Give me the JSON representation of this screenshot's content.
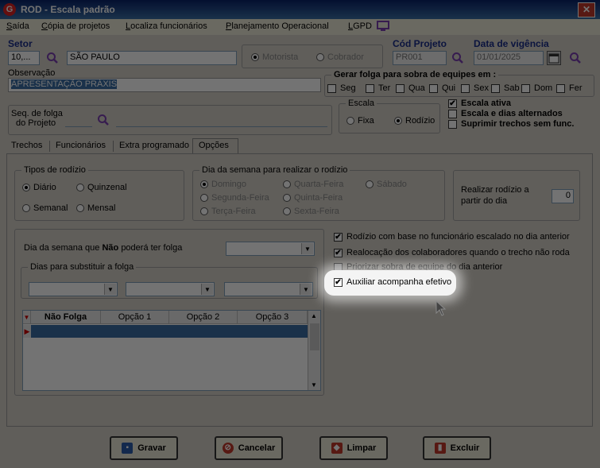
{
  "window": {
    "title": "ROD - Escala padrão"
  },
  "menu": {
    "items": [
      "Saída",
      "Cópia de projetos",
      "Localiza funcionários",
      "Planejamento Operacional",
      "LGPD"
    ],
    "underline": [
      "S",
      "C",
      "L",
      "P",
      "L"
    ]
  },
  "header": {
    "setor_label": "Setor",
    "setor_code": "10,...",
    "setor_name": "SÃO PAULO",
    "motorista": "Motorista",
    "cobrador": "Cobrador",
    "cod_projeto_label": "Cód Projeto",
    "cod_projeto_value": "PR001",
    "data_vigencia_label": "Data de vigência",
    "data_vigencia_value": "01/01/2025",
    "observacao_label": "Observação",
    "observacao_value": "APRESENTAÇÃO PRÁXIS"
  },
  "folga_equipes": {
    "title": "Gerar folga para sobra de equipes em :",
    "days": [
      "Seg",
      "Ter",
      "Qua",
      "Qui",
      "Sex",
      "Sab",
      "Dom",
      "Fer"
    ]
  },
  "seq_folga": {
    "label_line1": "Seq. de folga",
    "label_line2": "do Projeto"
  },
  "escala": {
    "title": "Escala",
    "fixa": "Fixa",
    "rodizio": "Rodízio"
  },
  "options_right": {
    "escala_ativa": "Escala ativa",
    "escala_dias_alternados": "Escala e dias alternados",
    "suprimir_trechos": "Suprimir trechos sem func."
  },
  "tabs": [
    "Trechos",
    "Funcionários",
    "Extra programado",
    "Opções"
  ],
  "tipos_rodizio": {
    "title": "Tipos de rodízio",
    "diario": "Diário",
    "quinzenal": "Quinzenal",
    "semanal": "Semanal",
    "mensal": "Mensal"
  },
  "dia_semana_rodizio": {
    "title": "Dia da semana para realizar o rodízio",
    "days": [
      "Domingo",
      "Quarta-Feira",
      "Sábado",
      "Segunda-Feira",
      "Quinta-Feira",
      "Terça-Feira",
      "Sexta-Feira"
    ]
  },
  "realizar_rodizio": {
    "label_line1": "Realizar rodízio a",
    "label_line2": "partir do dia",
    "value": "0"
  },
  "folga_section": {
    "dia_semana_pre": "Dia da semana que",
    "nao": "Não",
    "dia_semana_post": "poderá ter folga",
    "dias_substituir": "Dias para substituir a folga"
  },
  "grid": {
    "columns": [
      "Não Folga",
      "Opção 1",
      "Opção 2",
      "Opção 3"
    ]
  },
  "checks": {
    "rodizio_base": "Rodízio com base no funcionário escalado no dia anterior",
    "realocacao": "Realocação dos colaboradores quando o trecho não roda",
    "priorizar": "Priorizar sobra de equipe do dia anterior",
    "auxiliar": "Auxiliar acompanha efetivo"
  },
  "buttons": {
    "gravar": "Gravar",
    "cancelar": "Cancelar",
    "limpar": "Limpar",
    "excluir": "Excluir"
  },
  "colors": {
    "title_bar": "#0a246a",
    "label_blue": "#1a2d8a",
    "selection": "#3a6ea5"
  }
}
